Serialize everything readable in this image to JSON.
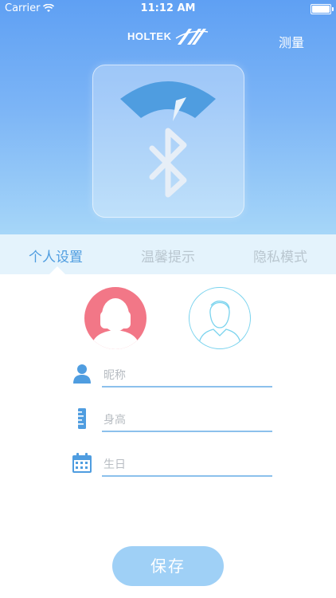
{
  "status_bar": {
    "carrier": "Carrier",
    "time": "11:12 AM"
  },
  "header": {
    "logo_text": "HOLTEK",
    "measure_label": "测量"
  },
  "tabs": [
    {
      "label": "个人设置",
      "active": true
    },
    {
      "label": "温馨提示",
      "active": false
    },
    {
      "label": "隐私模式",
      "active": false
    }
  ],
  "avatars": [
    {
      "gender": "female",
      "selected": true,
      "color": "#f27787"
    },
    {
      "gender": "male",
      "selected": false,
      "color": "#7ad3ee"
    }
  ],
  "form": {
    "nickname": {
      "placeholder": "昵称",
      "icon": "person-icon"
    },
    "height": {
      "placeholder": "身高",
      "icon": "ruler-icon"
    },
    "birthday": {
      "placeholder": "生日",
      "icon": "calendar-icon"
    }
  },
  "save_button": {
    "label": "保存"
  },
  "colors": {
    "accent": "#4f9de0",
    "hero_top": "#5fa0f3",
    "hero_bottom": "#a6d6f8"
  }
}
